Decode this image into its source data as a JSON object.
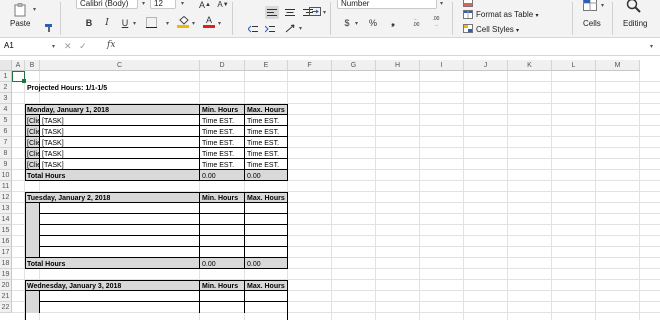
{
  "ribbon": {
    "paste_label": "Paste",
    "font_name": "Calibri (Body)",
    "font_size": "12",
    "number_format": "Number",
    "format_as_table": "Format as Table",
    "cell_styles": "Cell Styles",
    "cells_label": "Cells",
    "editing_label": "Editing",
    "bold": "B",
    "italic": "I",
    "underline": "U",
    "font_grow": "A",
    "font_shrink": "A",
    "currency": "$",
    "percent": "%",
    "comma": "❟",
    "inc_decimal": ".00",
    "dec_decimal": ".00",
    "fill_color": "#f5b800",
    "font_color": "#e02020"
  },
  "formula_bar": {
    "name_box": "A1",
    "fx": "fx",
    "formula": ""
  },
  "sheet": {
    "columns": [
      "A",
      "B",
      "C",
      "D",
      "E",
      "F",
      "G",
      "H",
      "I",
      "J",
      "K",
      "L",
      "M"
    ],
    "rows": [
      "1",
      "2",
      "3",
      "4",
      "5",
      "6",
      "7",
      "8",
      "9",
      "10",
      "11",
      "12",
      "13",
      "14",
      "15",
      "16",
      "17",
      "18",
      "19",
      "20",
      "21",
      "22"
    ],
    "title": "Projected Hours: 1/1-1/5",
    "min_hours": "Min. Hours",
    "max_hours": "Max. Hours",
    "total_hours": "Total Hours",
    "zero": "0.00",
    "client": "[Clie",
    "task": "[TASK]",
    "time_est": "Time EST.",
    "days": [
      "Monday, January 1, 2018",
      "Tuesday, January 2, 2018",
      "Wednesday, January 3, 2018"
    ]
  }
}
